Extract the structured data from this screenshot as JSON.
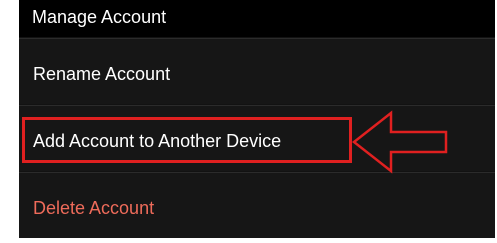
{
  "section": {
    "title": "Manage Account"
  },
  "menu": {
    "rename_label": "Rename Account",
    "add_device_label": "Add Account to Another Device",
    "delete_label": "Delete Account"
  },
  "colors": {
    "panel_background": "#121212",
    "header_background": "#000000",
    "text": "#ffffff",
    "destructive_text": "#ee6b5a",
    "annotation_red": "#e02020"
  }
}
